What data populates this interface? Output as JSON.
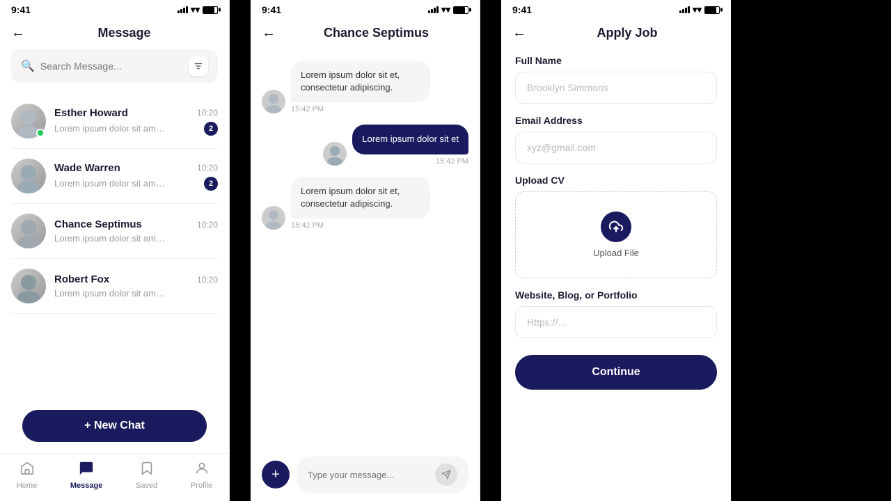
{
  "panel1": {
    "status_time": "9:41",
    "title": "Message",
    "back": "←",
    "search_placeholder": "Search Message...",
    "new_chat_label": "+ New Chat",
    "contacts": [
      {
        "name": "Esther Howard",
        "time": "10:20",
        "preview": "Lorem ipsum dolor sit amet...",
        "badge": 2,
        "online": true,
        "id": "esther"
      },
      {
        "name": "Wade Warren",
        "time": "10:20",
        "preview": "Lorem ipsum dolor sit amet...",
        "badge": 2,
        "online": false,
        "id": "wade"
      },
      {
        "name": "Chance Septimus",
        "time": "10:20",
        "preview": "Lorem ipsum dolor sit amet...",
        "badge": 0,
        "online": false,
        "id": "chance"
      },
      {
        "name": "Robert Fox",
        "time": "10:20",
        "preview": "Lorem ipsum dolor sit amet...",
        "badge": 0,
        "online": false,
        "id": "robert"
      }
    ],
    "nav": [
      {
        "id": "home",
        "label": "Home",
        "icon": "⌂",
        "active": false
      },
      {
        "id": "message",
        "label": "Message",
        "icon": "💬",
        "active": true
      },
      {
        "id": "saved",
        "label": "Saved",
        "icon": "🔖",
        "active": false
      },
      {
        "id": "profile",
        "label": "Profile",
        "icon": "👤",
        "active": false
      }
    ]
  },
  "panel2": {
    "status_time": "9:41",
    "title": "Chance Septimus",
    "messages": [
      {
        "id": "m1",
        "dir": "received",
        "text": "Lorem ipsum dolor sit et, consectetur adipiscing.",
        "time": "15:42 PM",
        "has_avatar": true
      },
      {
        "id": "m2",
        "dir": "sent",
        "text": "Lorem ipsum dolor sit et",
        "time": "15:42 PM",
        "has_avatar": true
      },
      {
        "id": "m3",
        "dir": "received",
        "text": "Lorem ipsum dolor sit et, consectetur adipiscing.",
        "time": "15:42 PM",
        "has_avatar": true
      }
    ],
    "input_placeholder": "Type your message..."
  },
  "panel3": {
    "status_time": "9:41",
    "title": "Apply Job",
    "fields": {
      "full_name_label": "Full Name",
      "full_name_placeholder": "Brooklyn Simmons",
      "email_label": "Email Address",
      "email_placeholder": "xyz@gmail.com",
      "cv_label": "Upload CV",
      "upload_label": "Upload File",
      "website_label": "Website, Blog, or Portfolio",
      "website_placeholder": "Https://..."
    },
    "continue_label": "Continue"
  }
}
